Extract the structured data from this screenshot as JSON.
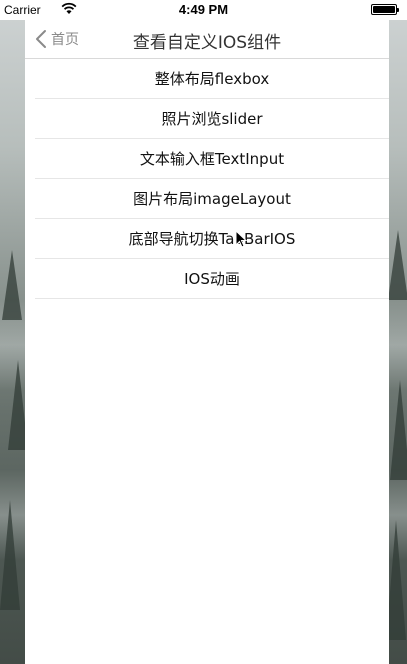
{
  "status_bar": {
    "carrier": "Carrier",
    "time": "4:49 PM",
    "wifi_icon": "wifi-icon",
    "battery_icon": "battery-icon",
    "battery_level": 1.0
  },
  "nav_bar": {
    "back_label": "首页",
    "back_icon": "chevron-left-icon",
    "title": "查看自定义IOS组件",
    "back_color": "#8a8a8a"
  },
  "menu": {
    "items": [
      {
        "label": "整体布局flexbox"
      },
      {
        "label": "照片浏览slider"
      },
      {
        "label": "文本输入框TextInput"
      },
      {
        "label": "图片布局imageLayout"
      },
      {
        "label": "底部导航切换TabBarIOS"
      },
      {
        "label": "IOS动画"
      }
    ]
  },
  "colors": {
    "panel_background": "#ffffff",
    "separator": "#e6e6e6",
    "text": "#111111"
  },
  "icons": {
    "cursor": "mouse-pointer-icon"
  }
}
